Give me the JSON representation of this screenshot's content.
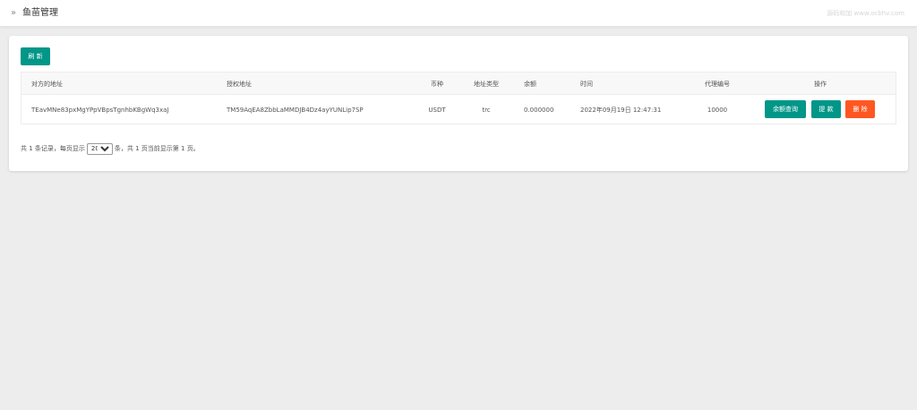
{
  "header": {
    "crumb_icon": "»",
    "title": "鱼苗管理",
    "watermark": "源码和加 www.ocbhv.com"
  },
  "toolbar": {
    "refresh_label": "刷 新"
  },
  "table": {
    "columns": [
      "对方的地址",
      "授权地址",
      "币种",
      "地址类型",
      "余额",
      "时间",
      "代理编号",
      "操作"
    ],
    "rows": [
      {
        "counterparty_address": "TEavMNe83pxMgYPpVBpsTgnhbKBgWq3xaJ",
        "authorized_address": "TM59AqEA8ZbbLaMMDJB4Dz4ayYUNLip7SP",
        "currency": "USDT",
        "address_type": "trc",
        "balance": "0.000000",
        "time": "2022年09月19日 12:47:31",
        "agent_id": "10000",
        "actions": {
          "query_label": "余额查询",
          "withdraw_label": "提 款",
          "delete_label": "删 除"
        }
      }
    ]
  },
  "pagination": {
    "prefix": "共 1 条记录，每页显示",
    "page_size": "20",
    "page_size_options": [
      "20"
    ],
    "suffix": "条，共 1 页当前显示第 1 页。"
  },
  "colors": {
    "primary": "#009688",
    "danger": "#ff5722",
    "background": "#ededed"
  }
}
